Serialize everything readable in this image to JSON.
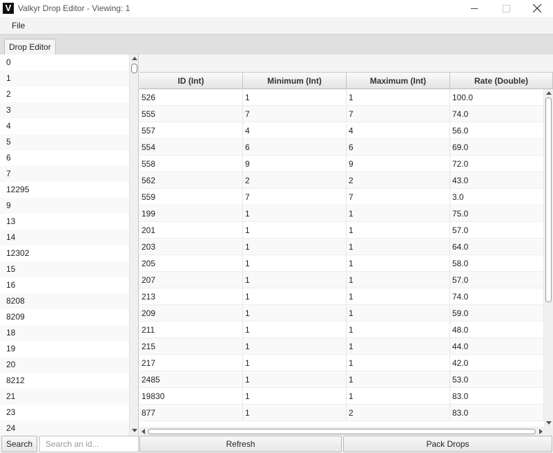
{
  "window": {
    "title": "Valkyr Drop Editor - Viewing: 1",
    "icon_letter": "V"
  },
  "menu": {
    "file": "File"
  },
  "tab": {
    "label": "Drop Editor"
  },
  "id_list": [
    "0",
    "1",
    "2",
    "3",
    "4",
    "5",
    "6",
    "7",
    "12295",
    "9",
    "13",
    "14",
    "12302",
    "15",
    "16",
    "8208",
    "8209",
    "18",
    "19",
    "20",
    "8212",
    "21",
    "23",
    "24"
  ],
  "table": {
    "columns": [
      "ID (Int)",
      "Minimum (Int)",
      "Maximum (Int)",
      "Rate (Double)"
    ],
    "rows": [
      [
        "526",
        "1",
        "1",
        "100.0"
      ],
      [
        "555",
        "7",
        "7",
        "74.0"
      ],
      [
        "557",
        "4",
        "4",
        "56.0"
      ],
      [
        "554",
        "6",
        "6",
        "69.0"
      ],
      [
        "558",
        "9",
        "9",
        "72.0"
      ],
      [
        "562",
        "2",
        "2",
        "43.0"
      ],
      [
        "559",
        "7",
        "7",
        "3.0"
      ],
      [
        "199",
        "1",
        "1",
        "75.0"
      ],
      [
        "201",
        "1",
        "1",
        "57.0"
      ],
      [
        "203",
        "1",
        "1",
        "64.0"
      ],
      [
        "205",
        "1",
        "1",
        "58.0"
      ],
      [
        "207",
        "1",
        "1",
        "57.0"
      ],
      [
        "213",
        "1",
        "1",
        "74.0"
      ],
      [
        "209",
        "1",
        "1",
        "59.0"
      ],
      [
        "211",
        "1",
        "1",
        "48.0"
      ],
      [
        "215",
        "1",
        "1",
        "44.0"
      ],
      [
        "217",
        "1",
        "1",
        "42.0"
      ],
      [
        "2485",
        "1",
        "1",
        "53.0"
      ],
      [
        "19830",
        "1",
        "1",
        "83.0"
      ],
      [
        "877",
        "1",
        "2",
        "83.0"
      ]
    ]
  },
  "bottom": {
    "search_label": "Search",
    "search_placeholder": "Search an id...",
    "refresh_label": "Refresh",
    "pack_label": "Pack Drops"
  }
}
